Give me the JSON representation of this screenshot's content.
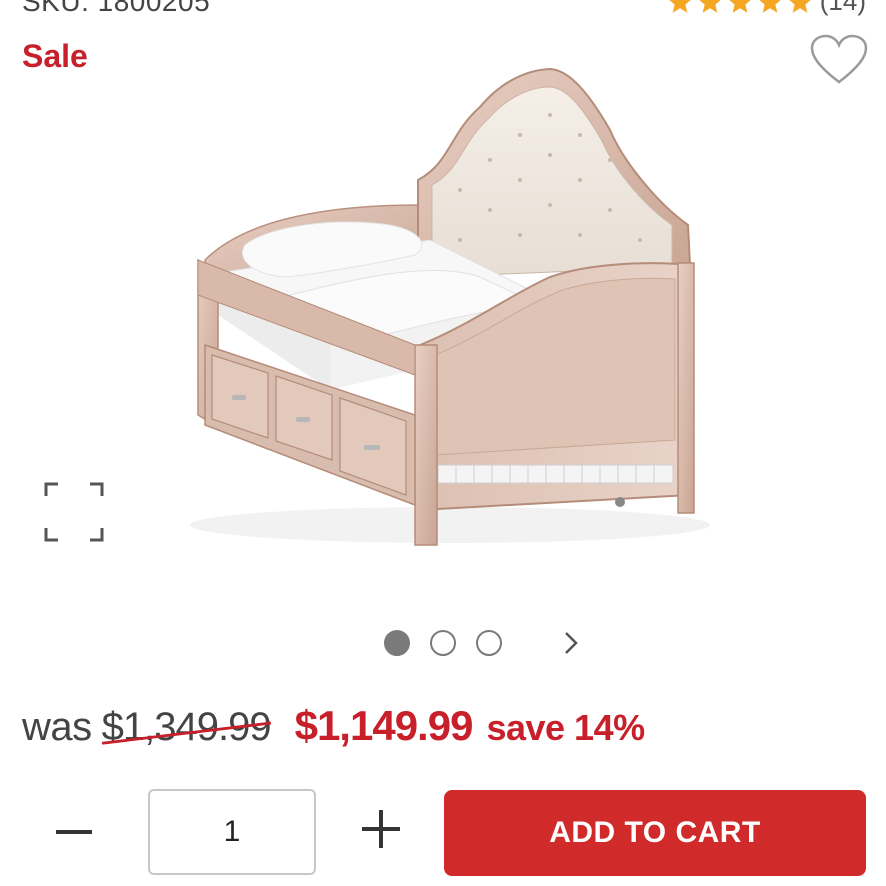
{
  "product": {
    "sku": "SKU: 1800205",
    "review_count": "(14)",
    "sale_label": "Sale",
    "rating": 5
  },
  "gallery": {
    "total_images": 3,
    "active_index": 0
  },
  "pricing": {
    "was_label": "was",
    "was_price": "$1,349.99",
    "sale_price": "$1,149.99",
    "save_text": "save 14%"
  },
  "cart": {
    "quantity": "1",
    "add_label": "ADD TO CART"
  },
  "colors": {
    "accent_red": "#c8202b",
    "button_red": "#d12a2a",
    "star_orange": "#f5a623"
  }
}
